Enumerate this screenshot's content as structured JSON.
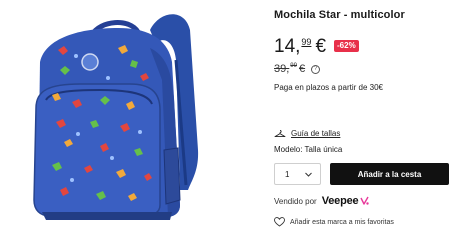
{
  "product": {
    "title": "Mochila Star - multicolor",
    "image_icon": "backpack-product-image"
  },
  "price": {
    "current_int": "14,",
    "current_cents": "99",
    "currency": "€",
    "discount": "-62%",
    "old_int": "39,",
    "old_cents": "99",
    "old_currency": "€",
    "info_icon_glyph": "?"
  },
  "installments": {
    "text": "Paga en plazos a partir de 30€"
  },
  "size": {
    "guide_label": "Guía de tallas",
    "model_text": "Modelo: Talla única"
  },
  "purchase": {
    "quantity": "1",
    "add_to_cart_label": "Añadir a la cesta"
  },
  "seller": {
    "sold_by_label": "Vendido por",
    "brand_name": "Veepee"
  },
  "favorite": {
    "label": "Añadir esta marca a mis favoritas"
  },
  "colors": {
    "discount_badge": "#e8304a",
    "button": "#111111",
    "veepee_accent": "#e8389a"
  }
}
